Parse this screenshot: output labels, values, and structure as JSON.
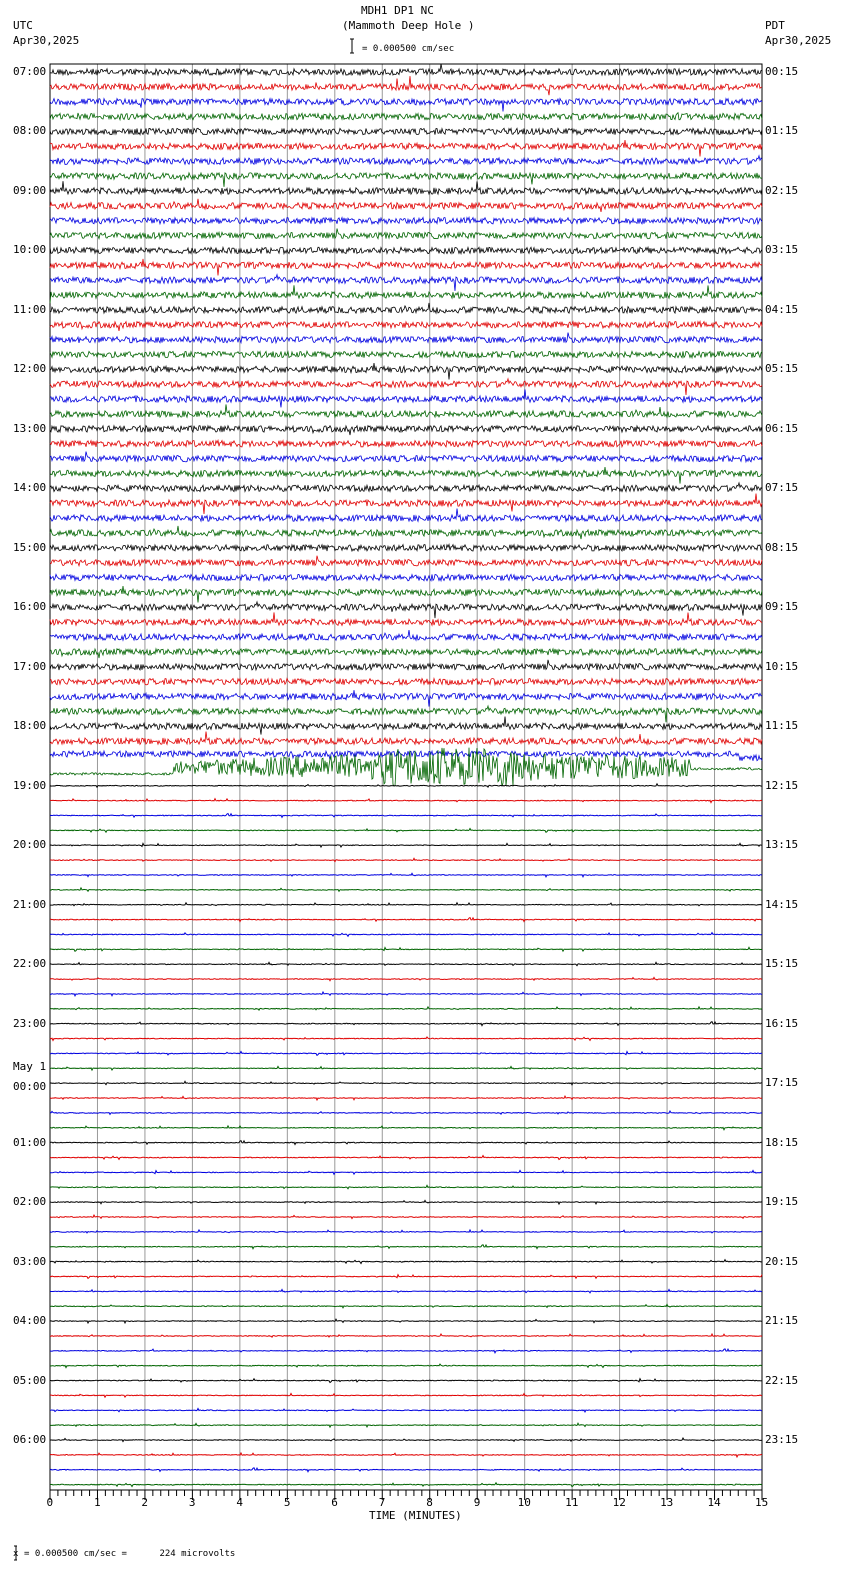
{
  "header": {
    "title": "MDH1 DP1 NC",
    "subtitle": "(Mammoth Deep Hole )",
    "scale_text": "= 0.000500 cm/sec",
    "left_tz": "UTC",
    "left_date": "Apr30,2025",
    "right_tz": "PDT",
    "right_date": "Apr30,2025"
  },
  "footer": {
    "scale_text": "= 0.000500 cm/sec =      224 microvolts",
    "mark": "x"
  },
  "chart_data": {
    "type": "line",
    "title": "MDH1 DP1 NC (Mammoth Deep Hole )",
    "xlabel": "TIME (MINUTES)",
    "xlim": [
      0,
      15
    ],
    "x_ticks": [
      "0",
      "1",
      "2",
      "3",
      "4",
      "5",
      "6",
      "7",
      "8",
      "9",
      "10",
      "11",
      "12",
      "13",
      "14",
      "15"
    ],
    "grid": true,
    "trace_colors": [
      "#000000",
      "#e00000",
      "#0000e0",
      "#006400"
    ],
    "traces_per_hour": 4,
    "left_labels": [
      "07:00",
      "08:00",
      "09:00",
      "10:00",
      "11:00",
      "12:00",
      "13:00",
      "14:00",
      "15:00",
      "16:00",
      "17:00",
      "18:00",
      "19:00",
      "20:00",
      "21:00",
      "22:00",
      "23:00",
      "00:00",
      "01:00",
      "02:00",
      "03:00",
      "04:00",
      "05:00",
      "06:00"
    ],
    "date_change_label": "May 1",
    "right_labels": [
      "00:15",
      "01:15",
      "02:15",
      "03:15",
      "04:15",
      "05:15",
      "06:15",
      "07:15",
      "08:15",
      "09:15",
      "10:15",
      "11:15",
      "12:15",
      "13:15",
      "14:15",
      "15:15",
      "16:15",
      "17:15",
      "18:15",
      "19:15",
      "20:15",
      "21:15",
      "22:15",
      "23:15"
    ],
    "noisy_until_utc": "18:45",
    "event": {
      "trace_utc": "18:45",
      "start_min": 2.6,
      "end_min": 13.5
    }
  }
}
